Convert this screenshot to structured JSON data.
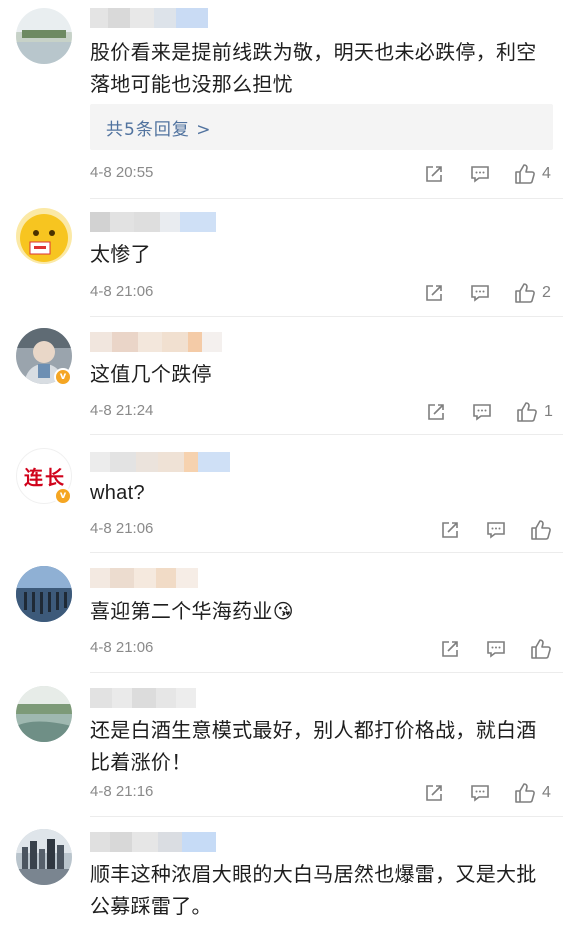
{
  "comments": [
    {
      "text": "股价看来是提前线跌为敬，明天也未必跌停，利空落地可能也没那么担忧",
      "replies": "共5条回复 >",
      "time": "4-8 20:55",
      "likes": "4",
      "avatar_icon": "lake-landscape-avatar",
      "verified": false
    },
    {
      "text": "太惨了",
      "time": "4-8 21:06",
      "likes": "2",
      "avatar_icon": "cartoon-face-avatar",
      "verified": false
    },
    {
      "text": "这值几个跌停",
      "time": "4-8 21:24",
      "likes": "1",
      "avatar_icon": "elderly-man-avatar",
      "verified": true
    },
    {
      "text": "what?",
      "time": "4-8 21:06",
      "likes": "",
      "avatar_icon": "text-logo-avatar",
      "avatar_text": "连长",
      "verified": true
    },
    {
      "text": "喜迎第二个华海药业😘",
      "time": "4-8 21:06",
      "likes": "",
      "avatar_icon": "pier-posts-avatar",
      "verified": false
    },
    {
      "text": "还是白酒生意模式最好，别人都打价格战，就白酒比着涨价！",
      "time": "4-8 21:16",
      "likes": "4",
      "avatar_icon": "river-landscape-avatar",
      "verified": false
    },
    {
      "text": "顺丰这种浓眉大眼的大白马居然也爆雷，又是大批公募踩雷了。",
      "avatar_icon": "city-skyline-avatar",
      "verified": false
    }
  ],
  "colors": {
    "link": "#51739f",
    "meta": "#8a8a8a",
    "verified": "#f5a623"
  }
}
